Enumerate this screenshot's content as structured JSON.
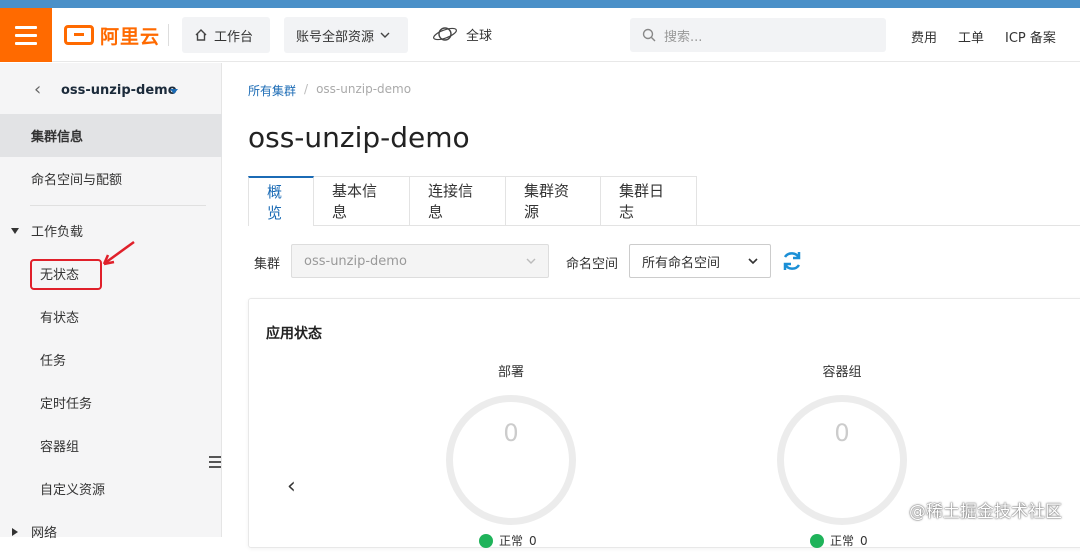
{
  "header": {
    "logo_text": "阿里云",
    "workbench_label": "工作台",
    "resources_label": "账号全部资源",
    "region_label": "全球",
    "search_placeholder": "搜索...",
    "links": [
      "费用",
      "工单",
      "ICP 备案"
    ],
    "brand_color": "#ff6a00"
  },
  "sidebar": {
    "cluster_name": "oss-unzip-demo",
    "items": [
      {
        "label": "集群信息",
        "active": true
      },
      {
        "label": "命名空间与配额"
      },
      {
        "label": "工作负载",
        "expanded": true
      },
      {
        "label": "无状态",
        "highlighted": true
      },
      {
        "label": "有状态"
      },
      {
        "label": "任务"
      },
      {
        "label": "定时任务"
      },
      {
        "label": "容器组"
      },
      {
        "label": "自定义资源"
      },
      {
        "label": "网络"
      }
    ]
  },
  "main": {
    "breadcrumb": [
      "所有集群",
      "oss-unzip-demo"
    ],
    "title": "oss-unzip-demo",
    "tabs": [
      "概览",
      "基本信息",
      "连接信息",
      "集群资源",
      "集群日志"
    ],
    "filters": {
      "cluster_label": "集群",
      "cluster_value": "oss-unzip-demo",
      "namespace_label": "命名空间",
      "namespace_value": "所有命名空间"
    },
    "card": {
      "title": "应用状态",
      "stats": [
        {
          "label": "部署",
          "value": "0",
          "status": "正常",
          "count": "0"
        },
        {
          "label": "容器组",
          "value": "0",
          "status": "正常",
          "count": "0"
        }
      ]
    }
  },
  "watermark": "@稀土掘金技术社区"
}
